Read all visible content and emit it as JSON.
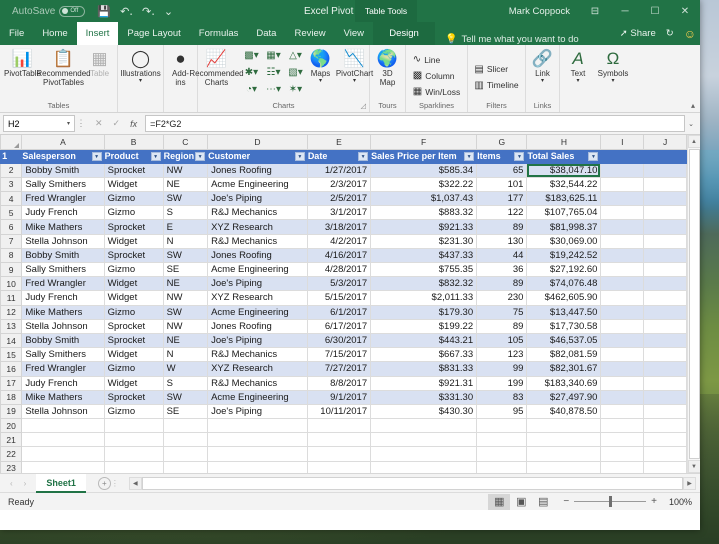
{
  "titlebar": {
    "autosave_label": "AutoSave",
    "autosave_state": "Off",
    "qat": [
      "save-icon",
      "undo-icon",
      "redo-icon",
      "customize-icon"
    ],
    "document_title": "Excel Pivot Table...",
    "contextual_tab": "Table Tools",
    "user_name": "Mark Coppock",
    "ribbon_display_icon": "ribbon-display-options",
    "minimize": "─",
    "maximize": "☐",
    "close": "✕"
  },
  "tabs": [
    {
      "label": "File",
      "active": false
    },
    {
      "label": "Home",
      "active": false
    },
    {
      "label": "Insert",
      "active": true
    },
    {
      "label": "Page Layout",
      "active": false
    },
    {
      "label": "Formulas",
      "active": false
    },
    {
      "label": "Data",
      "active": false
    },
    {
      "label": "Review",
      "active": false
    },
    {
      "label": "View",
      "active": false
    },
    {
      "label": "Design",
      "active": false,
      "contextual": true
    }
  ],
  "tellme": {
    "placeholder": "Tell me what you want to do"
  },
  "tab_right": {
    "share": "Share",
    "history_icon": "history-icon",
    "account_icon": "smiley-icon"
  },
  "ribbon": {
    "groups": [
      {
        "label": "Tables",
        "buttons": [
          {
            "label": "PivotTable",
            "icon": "pivottable-icon",
            "disabled": false
          },
          {
            "label": "Recommended PivotTables",
            "icon": "recommended-pivottables-icon",
            "disabled": false
          },
          {
            "label": "Table",
            "icon": "table-icon",
            "disabled": true
          }
        ]
      },
      {
        "label": "",
        "buttons": [
          {
            "label": "Illustrations",
            "icon": "illustrations-icon",
            "disabled": false
          }
        ]
      },
      {
        "label": "",
        "buttons": [
          {
            "label": "Add-ins",
            "icon": "addins-icon",
            "disabled": false
          }
        ]
      },
      {
        "label": "Charts",
        "buttons": [
          {
            "label": "Recommended Charts",
            "icon": "recommended-charts-icon",
            "disabled": false
          },
          {
            "label": "Maps",
            "icon": "maps-icon",
            "disabled": false
          },
          {
            "label": "PivotChart",
            "icon": "pivotchart-icon",
            "disabled": false
          }
        ]
      },
      {
        "label": "Tours",
        "buttons": [
          {
            "label": "3D Map",
            "icon": "3d-map-icon",
            "disabled": false
          }
        ]
      },
      {
        "label": "Sparklines",
        "buttons": [
          {
            "label": "Line",
            "icon": "sparkline-line-icon"
          },
          {
            "label": "Column",
            "icon": "sparkline-column-icon"
          },
          {
            "label": "Win/Loss",
            "icon": "sparkline-winloss-icon"
          }
        ]
      },
      {
        "label": "Filters",
        "buttons": [
          {
            "label": "Slicer",
            "icon": "slicer-icon"
          },
          {
            "label": "Timeline",
            "icon": "timeline-icon"
          }
        ]
      },
      {
        "label": "Links",
        "buttons": [
          {
            "label": "Link",
            "icon": "link-icon"
          }
        ]
      },
      {
        "label": "",
        "buttons": [
          {
            "label": "Text",
            "icon": "text-icon"
          },
          {
            "label": "Symbols",
            "icon": "symbols-icon"
          }
        ]
      }
    ],
    "collapse_icon": "collapse-ribbon-caret"
  },
  "formula_bar": {
    "name_box": "H2",
    "cancel_icon": "✕",
    "confirm_icon": "✓",
    "fx_label": "fx",
    "formula": "=F2*G2",
    "expand_icon": "⌄"
  },
  "grid": {
    "column_letters": [
      "A",
      "B",
      "C",
      "D",
      "E",
      "F",
      "G",
      "H",
      "I",
      "J"
    ],
    "headers": [
      "Salesperson",
      "Product",
      "Region",
      "Customer",
      "Date",
      "Sales Price per Item",
      "Items",
      "Total Sales"
    ],
    "rows": [
      {
        "n": 2,
        "cells": [
          "Bobby Smith",
          "Sprocket",
          "NW",
          "Jones Roofing",
          "1/27/2017",
          "$585.34",
          "65",
          "$38,047.10"
        ]
      },
      {
        "n": 3,
        "cells": [
          "Sally Smithers",
          "Widget",
          "NE",
          "Acme Engineering",
          "2/3/2017",
          "$322.22",
          "101",
          "$32,544.22"
        ]
      },
      {
        "n": 4,
        "cells": [
          "Fred Wrangler",
          "Gizmo",
          "SW",
          "Joe's Piping",
          "2/5/2017",
          "$1,037.43",
          "177",
          "$183,625.11"
        ]
      },
      {
        "n": 5,
        "cells": [
          "Judy French",
          "Gizmo",
          "S",
          "R&J Mechanics",
          "3/1/2017",
          "$883.32",
          "122",
          "$107,765.04"
        ]
      },
      {
        "n": 6,
        "cells": [
          "Mike Mathers",
          "Sprocket",
          "E",
          "XYZ Research",
          "3/18/2017",
          "$921.33",
          "89",
          "$81,998.37"
        ]
      },
      {
        "n": 7,
        "cells": [
          "Stella Johnson",
          "Widget",
          "N",
          "R&J Mechanics",
          "4/2/2017",
          "$231.30",
          "130",
          "$30,069.00"
        ]
      },
      {
        "n": 8,
        "cells": [
          "Bobby Smith",
          "Sprocket",
          "SW",
          "Jones Roofing",
          "4/16/2017",
          "$437.33",
          "44",
          "$19,242.52"
        ]
      },
      {
        "n": 9,
        "cells": [
          "Sally Smithers",
          "Gizmo",
          "SE",
          "Acme Engineering",
          "4/28/2017",
          "$755.35",
          "36",
          "$27,192.60"
        ]
      },
      {
        "n": 10,
        "cells": [
          "Fred Wrangler",
          "Widget",
          "NE",
          "Joe's Piping",
          "5/3/2017",
          "$832.32",
          "89",
          "$74,076.48"
        ]
      },
      {
        "n": 11,
        "cells": [
          "Judy French",
          "Widget",
          "NW",
          "XYZ Research",
          "5/15/2017",
          "$2,011.33",
          "230",
          "$462,605.90"
        ]
      },
      {
        "n": 12,
        "cells": [
          "Mike Mathers",
          "Gizmo",
          "SW",
          "Acme Engineering",
          "6/1/2017",
          "$179.30",
          "75",
          "$13,447.50"
        ]
      },
      {
        "n": 13,
        "cells": [
          "Stella Johnson",
          "Sprocket",
          "NW",
          "Jones Roofing",
          "6/17/2017",
          "$199.22",
          "89",
          "$17,730.58"
        ]
      },
      {
        "n": 14,
        "cells": [
          "Bobby Smith",
          "Sprocket",
          "NE",
          "Joe's Piping",
          "6/30/2017",
          "$443.21",
          "105",
          "$46,537.05"
        ]
      },
      {
        "n": 15,
        "cells": [
          "Sally Smithers",
          "Widget",
          "N",
          "R&J Mechanics",
          "7/15/2017",
          "$667.33",
          "123",
          "$82,081.59"
        ]
      },
      {
        "n": 16,
        "cells": [
          "Fred Wrangler",
          "Gizmo",
          "W",
          "XYZ Research",
          "7/27/2017",
          "$831.33",
          "99",
          "$82,301.67"
        ]
      },
      {
        "n": 17,
        "cells": [
          "Judy French",
          "Widget",
          "S",
          "R&J Mechanics",
          "8/8/2017",
          "$921.31",
          "199",
          "$183,340.69"
        ]
      },
      {
        "n": 18,
        "cells": [
          "Mike Mathers",
          "Sprocket",
          "SW",
          "Acme Engineering",
          "9/1/2017",
          "$331.30",
          "83",
          "$27,497.90"
        ]
      },
      {
        "n": 19,
        "cells": [
          "Stella Johnson",
          "Gizmo",
          "SE",
          "Joe's Piping",
          "10/11/2017",
          "$430.30",
          "95",
          "$40,878.50"
        ]
      },
      {
        "n": 20,
        "cells": [
          "",
          "",
          "",
          "",
          "",
          "",
          "",
          ""
        ]
      },
      {
        "n": 21,
        "cells": [
          "",
          "",
          "",
          "",
          "",
          "",
          "",
          ""
        ]
      },
      {
        "n": 22,
        "cells": [
          "",
          "",
          "",
          "",
          "",
          "",
          "",
          ""
        ]
      },
      {
        "n": 23,
        "cells": [
          "",
          "",
          "",
          "",
          "",
          "",
          "",
          ""
        ]
      },
      {
        "n": 24,
        "cells": [
          "",
          "",
          "",
          "",
          "",
          "",
          "",
          ""
        ]
      },
      {
        "n": 25,
        "cells": [
          "",
          "",
          "",
          "",
          "",
          "",
          "",
          ""
        ]
      }
    ],
    "header_row_number": "1",
    "selected_cell": "H2"
  },
  "sheet_tabs": {
    "prev_icon": "‹",
    "next_icon": "›",
    "sheets": [
      {
        "name": "Sheet1",
        "active": true
      }
    ],
    "add_sheet_icon": "+"
  },
  "status_bar": {
    "status": "Ready",
    "views": [
      {
        "name": "normal-view",
        "icon": "▦",
        "active": true
      },
      {
        "name": "page-layout-view",
        "icon": "▣",
        "active": false
      },
      {
        "name": "page-break-view",
        "icon": "▤",
        "active": false
      }
    ],
    "zoom_out": "−",
    "zoom_in": "+",
    "zoom_level": "100%"
  },
  "colors": {
    "excel_green": "#217346",
    "table_header_blue": "#4472c4",
    "band_blue": "#d9e1f2"
  }
}
